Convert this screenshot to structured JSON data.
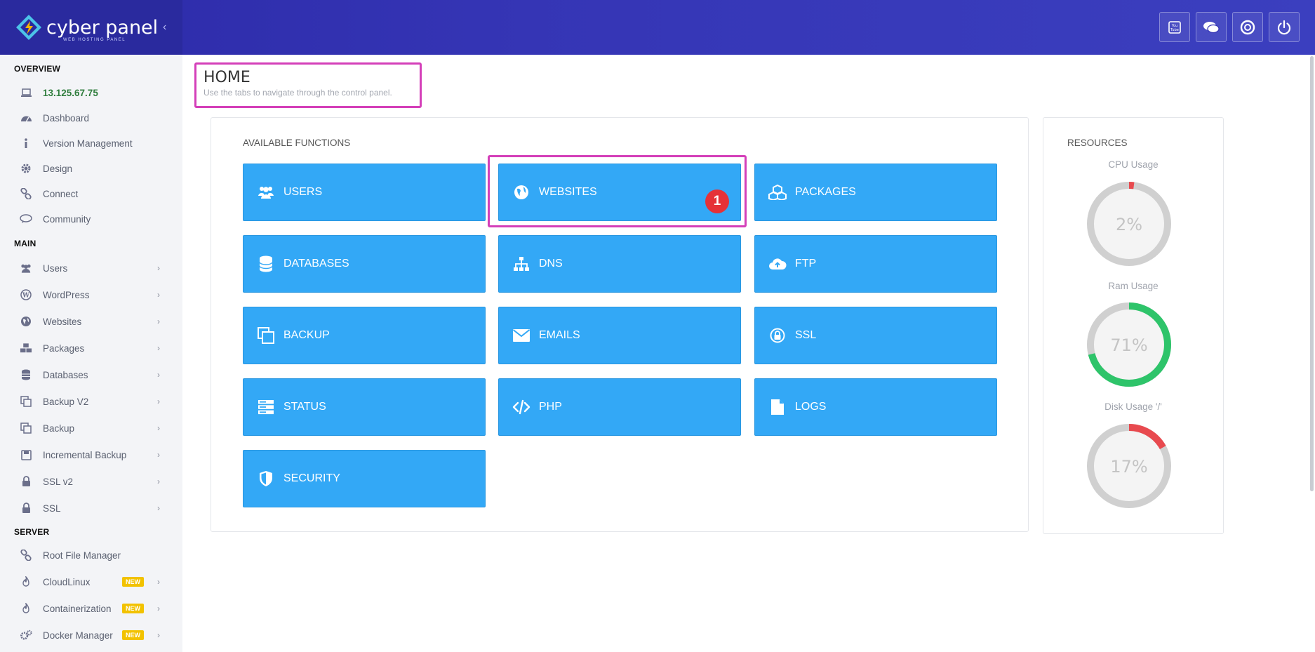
{
  "app": {
    "logo_text": "cyber panel",
    "logo_sub": "WEB HOSTING PANEL"
  },
  "topbar": {
    "icons": [
      "youtube-icon",
      "chat-icon",
      "support-icon",
      "power-icon"
    ]
  },
  "sidebar": {
    "sections": {
      "overview": "OVERVIEW",
      "main": "MAIN",
      "server": "SERVER"
    },
    "overview_items": [
      {
        "label": "13.125.67.75",
        "icon": "laptop-icon"
      },
      {
        "label": "Dashboard",
        "icon": "dashboard-icon"
      },
      {
        "label": "Version Management",
        "icon": "info-icon"
      },
      {
        "label": "Design",
        "icon": "gear-icon"
      },
      {
        "label": "Connect",
        "icon": "link-icon"
      },
      {
        "label": "Community",
        "icon": "comment-icon"
      }
    ],
    "main_items": [
      {
        "label": "Users",
        "icon": "users-icon"
      },
      {
        "label": "WordPress",
        "icon": "wordpress-icon"
      },
      {
        "label": "Websites",
        "icon": "globe-icon"
      },
      {
        "label": "Packages",
        "icon": "cubes-icon"
      },
      {
        "label": "Databases",
        "icon": "database-icon"
      },
      {
        "label": "Backup V2",
        "icon": "copy-icon"
      },
      {
        "label": "Backup",
        "icon": "copy-icon"
      },
      {
        "label": "Incremental Backup",
        "icon": "save-icon"
      },
      {
        "label": "SSL v2",
        "icon": "lock-icon"
      },
      {
        "label": "SSL",
        "icon": "lock-icon"
      }
    ],
    "server_items": [
      {
        "label": "Root File Manager",
        "icon": "link-icon"
      },
      {
        "label": "CloudLinux",
        "icon": "fire-icon",
        "badge": "NEW"
      },
      {
        "label": "Containerization",
        "icon": "fire-icon",
        "badge": "NEW"
      },
      {
        "label": "Docker Manager",
        "icon": "cogs-icon",
        "badge": "NEW"
      }
    ]
  },
  "header": {
    "title": "HOME",
    "subtitle": "Use the tabs to navigate through the control panel."
  },
  "functions": {
    "title": "AVAILABLE FUNCTIONS",
    "tiles": [
      {
        "label": "USERS",
        "icon": "users-icon"
      },
      {
        "label": "WEBSITES",
        "icon": "globe-icon"
      },
      {
        "label": "PACKAGES",
        "icon": "cubes-icon"
      },
      {
        "label": "DATABASES",
        "icon": "database-icon"
      },
      {
        "label": "DNS",
        "icon": "sitemap-icon"
      },
      {
        "label": "FTP",
        "icon": "cloud-upload-icon"
      },
      {
        "label": "BACKUP",
        "icon": "copy-icon"
      },
      {
        "label": "EMAILS",
        "icon": "envelope-icon"
      },
      {
        "label": "SSL",
        "icon": "lock-icon"
      },
      {
        "label": "STATUS",
        "icon": "server-icon"
      },
      {
        "label": "PHP",
        "icon": "code-icon"
      },
      {
        "label": "LOGS",
        "icon": "file-icon"
      },
      {
        "label": "SECURITY",
        "icon": "shield-icon"
      }
    ],
    "step_badge": "1"
  },
  "resources": {
    "title": "RESOURCES",
    "gauges": [
      {
        "label": "CPU Usage",
        "value": 2,
        "display": "2%",
        "color": "#e84a4f"
      },
      {
        "label": "Ram Usage",
        "value": 71,
        "display": "71%",
        "color": "#2ec46a"
      },
      {
        "label": "Disk Usage '/'",
        "value": 17,
        "display": "17%",
        "color": "#e84a4f"
      }
    ]
  },
  "colors": {
    "tile": "#33a8f6",
    "highlight": "#d43fb9",
    "topbar": "#2c2aa8"
  }
}
